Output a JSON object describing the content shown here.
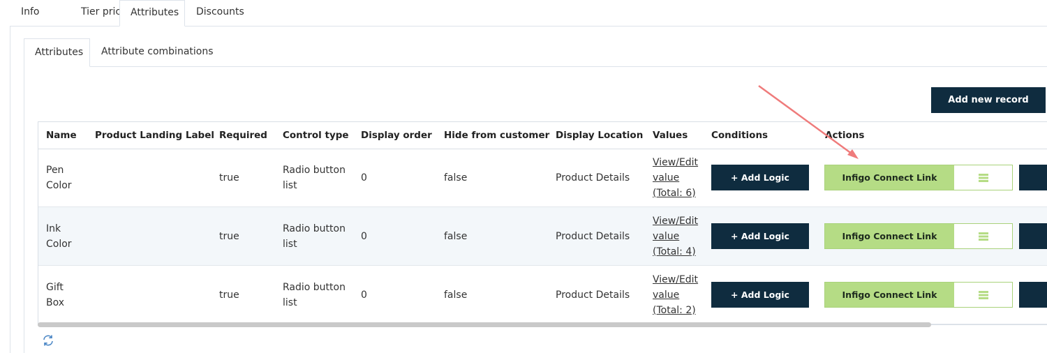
{
  "top_tabs": [
    "Info",
    "Tier prices",
    "Attributes",
    "Discounts"
  ],
  "sub_tabs": [
    "Attributes",
    "Attribute combinations"
  ],
  "add_button": "Add new record",
  "columns": [
    "Name",
    "Product Landing Label",
    "Required",
    "Control type",
    "Display order",
    "Hide from customer",
    "Display Location",
    "Values",
    "Conditions",
    "Actions"
  ],
  "rows": [
    {
      "name": [
        "Pen",
        "Color"
      ],
      "landing": "",
      "required": "true",
      "control": [
        "Radio button",
        "list"
      ],
      "order": "0",
      "hide": "false",
      "location": "Product Details",
      "values": [
        "View/Edit",
        "value",
        "(Total: 6)"
      ]
    },
    {
      "name": [
        "Ink",
        "Color"
      ],
      "landing": "",
      "required": "true",
      "control": [
        "Radio button",
        "list"
      ],
      "order": "0",
      "hide": "false",
      "location": "Product Details",
      "values": [
        "View/Edit",
        "value",
        "(Total: 4)"
      ]
    },
    {
      "name": [
        "Gift",
        "Box"
      ],
      "landing": "",
      "required": "true",
      "control": [
        "Radio button",
        "list"
      ],
      "order": "0",
      "hide": "false",
      "location": "Product Details",
      "values": [
        "View/Edit",
        "value",
        "(Total: 2)"
      ]
    }
  ],
  "add_logic_label": "+ Add Logic",
  "connect_label": "Infigo Connect Link",
  "icons": {
    "connect_side": "list-icon",
    "refresh": "refresh-icon"
  },
  "colors": {
    "dark_button": "#0f2c3f",
    "connect_green": "#b5dc85",
    "annotation_arrow": "#ef7b7b"
  }
}
